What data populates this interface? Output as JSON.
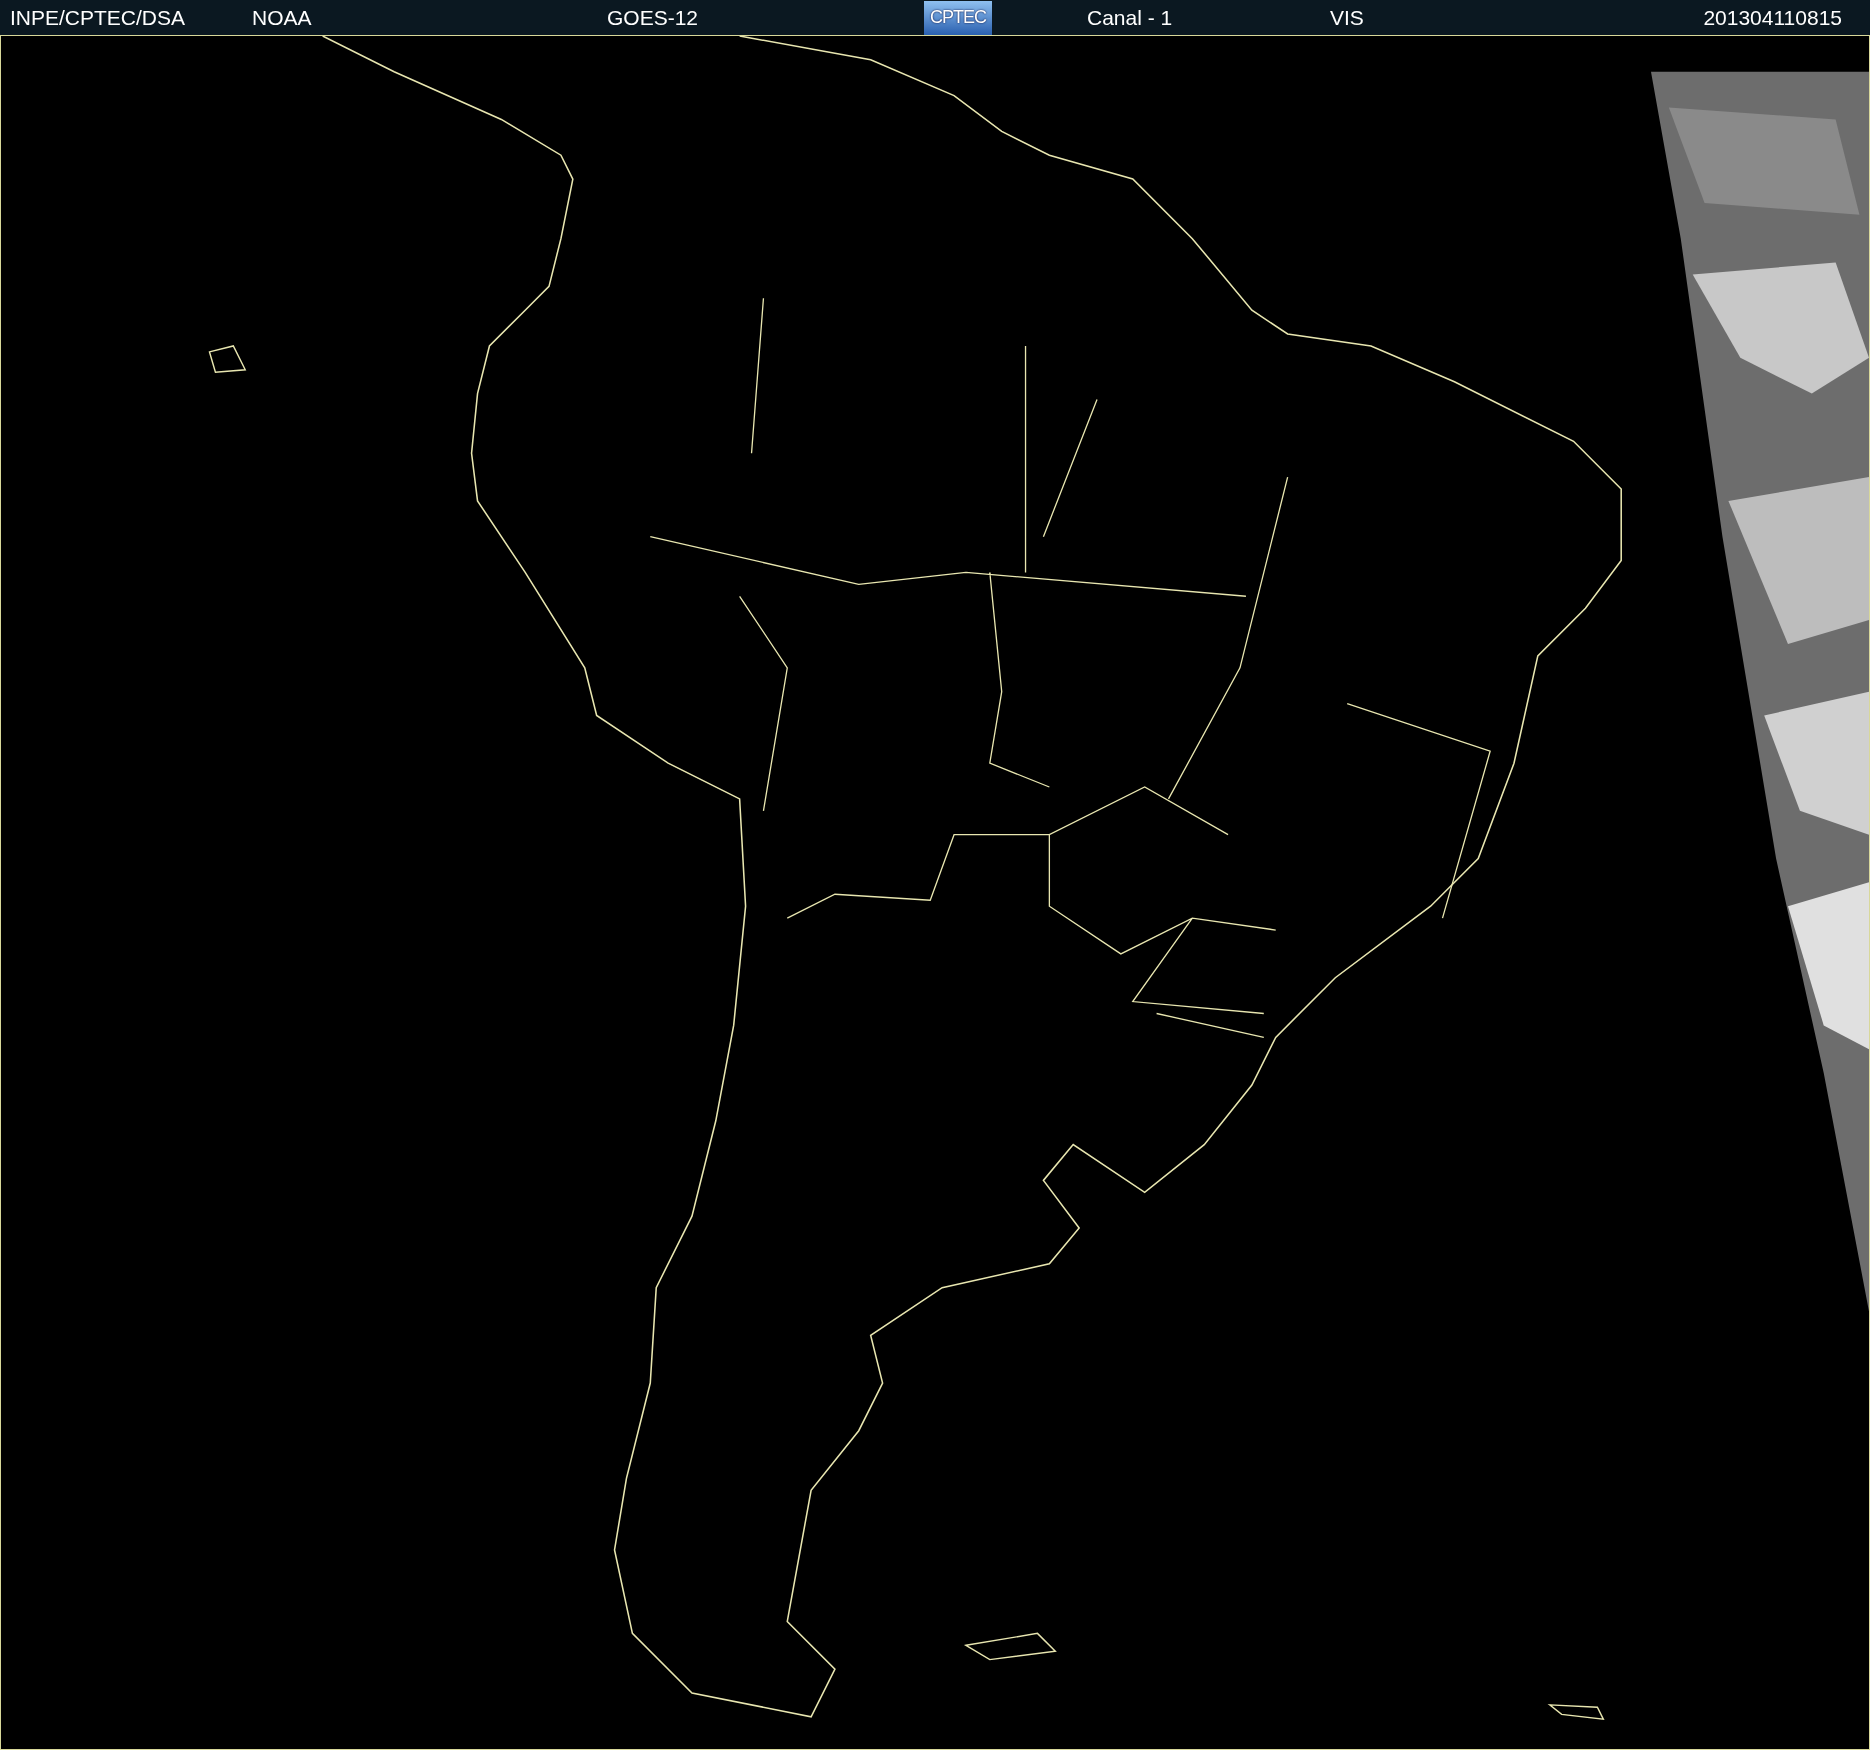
{
  "header": {
    "items": [
      {
        "kind": "text",
        "text": "INPE/CPTEC/DSA"
      },
      {
        "kind": "text",
        "text": "NOAA"
      },
      {
        "kind": "text",
        "text": "GOES-12"
      },
      {
        "kind": "logo",
        "text": "CPTEC"
      },
      {
        "kind": "text",
        "text": "Canal - 1"
      },
      {
        "kind": "text",
        "text": "VIS"
      },
      {
        "kind": "text",
        "text": "201304110815"
      }
    ]
  }
}
